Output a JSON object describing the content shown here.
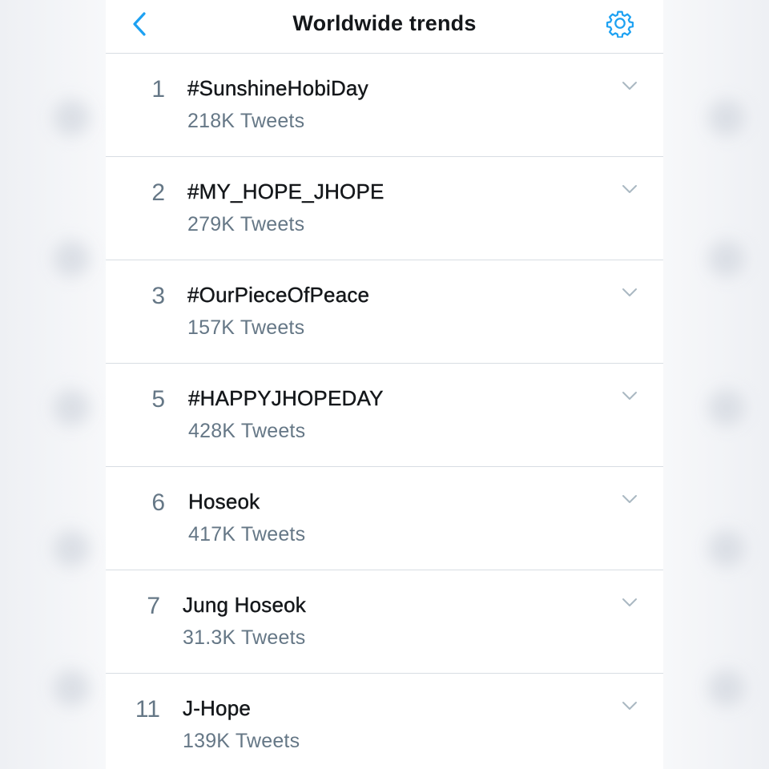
{
  "header": {
    "title": "Worldwide trends",
    "back_icon": "chevron-left-icon",
    "settings_icon": "gear-icon"
  },
  "colors": {
    "accent": "#1da1f2",
    "text_primary": "#14171a",
    "text_secondary": "#657786",
    "divider": "#d8dde3"
  },
  "trends": [
    {
      "rank": "1",
      "name": "#SunshineHobiDay",
      "count": "218K Tweets"
    },
    {
      "rank": "2",
      "name": "#MY_HOPE_JHOPE",
      "count": "279K Tweets"
    },
    {
      "rank": "3",
      "name": "#OurPieceOfPeace",
      "count": "157K Tweets"
    },
    {
      "rank": "5",
      "name": "#HAPPYJHOPEDAY",
      "count": "428K Tweets"
    },
    {
      "rank": "6",
      "name": "Hoseok",
      "count": "417K Tweets"
    },
    {
      "rank": "7",
      "name": "Jung Hoseok",
      "count": "31.3K Tweets"
    },
    {
      "rank": "11",
      "name": "J-Hope",
      "count": "139K Tweets"
    }
  ]
}
